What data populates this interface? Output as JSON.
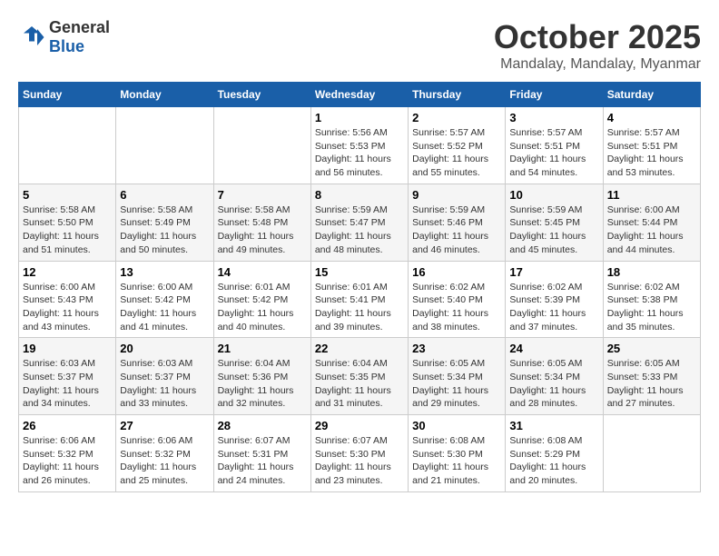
{
  "logo": {
    "general": "General",
    "blue": "Blue"
  },
  "title": "October 2025",
  "location": "Mandalay, Mandalay, Myanmar",
  "days_header": [
    "Sunday",
    "Monday",
    "Tuesday",
    "Wednesday",
    "Thursday",
    "Friday",
    "Saturday"
  ],
  "weeks": [
    [
      {
        "day": "",
        "info": ""
      },
      {
        "day": "",
        "info": ""
      },
      {
        "day": "",
        "info": ""
      },
      {
        "day": "1",
        "sunrise": "Sunrise: 5:56 AM",
        "sunset": "Sunset: 5:53 PM",
        "daylight": "Daylight: 11 hours and 56 minutes."
      },
      {
        "day": "2",
        "sunrise": "Sunrise: 5:57 AM",
        "sunset": "Sunset: 5:52 PM",
        "daylight": "Daylight: 11 hours and 55 minutes."
      },
      {
        "day": "3",
        "sunrise": "Sunrise: 5:57 AM",
        "sunset": "Sunset: 5:51 PM",
        "daylight": "Daylight: 11 hours and 54 minutes."
      },
      {
        "day": "4",
        "sunrise": "Sunrise: 5:57 AM",
        "sunset": "Sunset: 5:51 PM",
        "daylight": "Daylight: 11 hours and 53 minutes."
      }
    ],
    [
      {
        "day": "5",
        "sunrise": "Sunrise: 5:58 AM",
        "sunset": "Sunset: 5:50 PM",
        "daylight": "Daylight: 11 hours and 51 minutes."
      },
      {
        "day": "6",
        "sunrise": "Sunrise: 5:58 AM",
        "sunset": "Sunset: 5:49 PM",
        "daylight": "Daylight: 11 hours and 50 minutes."
      },
      {
        "day": "7",
        "sunrise": "Sunrise: 5:58 AM",
        "sunset": "Sunset: 5:48 PM",
        "daylight": "Daylight: 11 hours and 49 minutes."
      },
      {
        "day": "8",
        "sunrise": "Sunrise: 5:59 AM",
        "sunset": "Sunset: 5:47 PM",
        "daylight": "Daylight: 11 hours and 48 minutes."
      },
      {
        "day": "9",
        "sunrise": "Sunrise: 5:59 AM",
        "sunset": "Sunset: 5:46 PM",
        "daylight": "Daylight: 11 hours and 46 minutes."
      },
      {
        "day": "10",
        "sunrise": "Sunrise: 5:59 AM",
        "sunset": "Sunset: 5:45 PM",
        "daylight": "Daylight: 11 hours and 45 minutes."
      },
      {
        "day": "11",
        "sunrise": "Sunrise: 6:00 AM",
        "sunset": "Sunset: 5:44 PM",
        "daylight": "Daylight: 11 hours and 44 minutes."
      }
    ],
    [
      {
        "day": "12",
        "sunrise": "Sunrise: 6:00 AM",
        "sunset": "Sunset: 5:43 PM",
        "daylight": "Daylight: 11 hours and 43 minutes."
      },
      {
        "day": "13",
        "sunrise": "Sunrise: 6:00 AM",
        "sunset": "Sunset: 5:42 PM",
        "daylight": "Daylight: 11 hours and 41 minutes."
      },
      {
        "day": "14",
        "sunrise": "Sunrise: 6:01 AM",
        "sunset": "Sunset: 5:42 PM",
        "daylight": "Daylight: 11 hours and 40 minutes."
      },
      {
        "day": "15",
        "sunrise": "Sunrise: 6:01 AM",
        "sunset": "Sunset: 5:41 PM",
        "daylight": "Daylight: 11 hours and 39 minutes."
      },
      {
        "day": "16",
        "sunrise": "Sunrise: 6:02 AM",
        "sunset": "Sunset: 5:40 PM",
        "daylight": "Daylight: 11 hours and 38 minutes."
      },
      {
        "day": "17",
        "sunrise": "Sunrise: 6:02 AM",
        "sunset": "Sunset: 5:39 PM",
        "daylight": "Daylight: 11 hours and 37 minutes."
      },
      {
        "day": "18",
        "sunrise": "Sunrise: 6:02 AM",
        "sunset": "Sunset: 5:38 PM",
        "daylight": "Daylight: 11 hours and 35 minutes."
      }
    ],
    [
      {
        "day": "19",
        "sunrise": "Sunrise: 6:03 AM",
        "sunset": "Sunset: 5:37 PM",
        "daylight": "Daylight: 11 hours and 34 minutes."
      },
      {
        "day": "20",
        "sunrise": "Sunrise: 6:03 AM",
        "sunset": "Sunset: 5:37 PM",
        "daylight": "Daylight: 11 hours and 33 minutes."
      },
      {
        "day": "21",
        "sunrise": "Sunrise: 6:04 AM",
        "sunset": "Sunset: 5:36 PM",
        "daylight": "Daylight: 11 hours and 32 minutes."
      },
      {
        "day": "22",
        "sunrise": "Sunrise: 6:04 AM",
        "sunset": "Sunset: 5:35 PM",
        "daylight": "Daylight: 11 hours and 31 minutes."
      },
      {
        "day": "23",
        "sunrise": "Sunrise: 6:05 AM",
        "sunset": "Sunset: 5:34 PM",
        "daylight": "Daylight: 11 hours and 29 minutes."
      },
      {
        "day": "24",
        "sunrise": "Sunrise: 6:05 AM",
        "sunset": "Sunset: 5:34 PM",
        "daylight": "Daylight: 11 hours and 28 minutes."
      },
      {
        "day": "25",
        "sunrise": "Sunrise: 6:05 AM",
        "sunset": "Sunset: 5:33 PM",
        "daylight": "Daylight: 11 hours and 27 minutes."
      }
    ],
    [
      {
        "day": "26",
        "sunrise": "Sunrise: 6:06 AM",
        "sunset": "Sunset: 5:32 PM",
        "daylight": "Daylight: 11 hours and 26 minutes."
      },
      {
        "day": "27",
        "sunrise": "Sunrise: 6:06 AM",
        "sunset": "Sunset: 5:32 PM",
        "daylight": "Daylight: 11 hours and 25 minutes."
      },
      {
        "day": "28",
        "sunrise": "Sunrise: 6:07 AM",
        "sunset": "Sunset: 5:31 PM",
        "daylight": "Daylight: 11 hours and 24 minutes."
      },
      {
        "day": "29",
        "sunrise": "Sunrise: 6:07 AM",
        "sunset": "Sunset: 5:30 PM",
        "daylight": "Daylight: 11 hours and 23 minutes."
      },
      {
        "day": "30",
        "sunrise": "Sunrise: 6:08 AM",
        "sunset": "Sunset: 5:30 PM",
        "daylight": "Daylight: 11 hours and 21 minutes."
      },
      {
        "day": "31",
        "sunrise": "Sunrise: 6:08 AM",
        "sunset": "Sunset: 5:29 PM",
        "daylight": "Daylight: 11 hours and 20 minutes."
      },
      {
        "day": "",
        "info": ""
      }
    ]
  ]
}
